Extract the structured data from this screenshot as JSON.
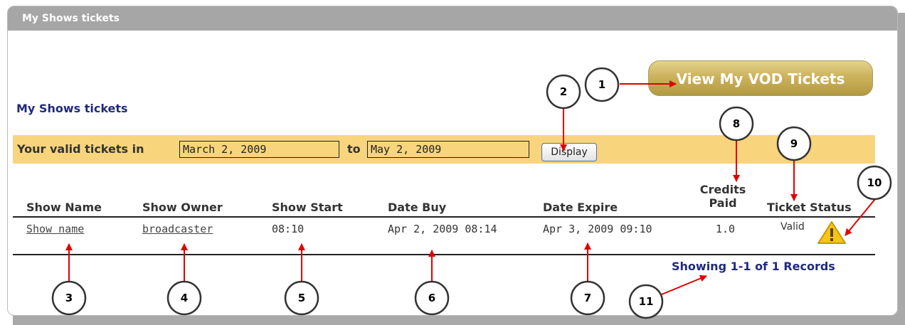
{
  "panel": {
    "header_title": "My Shows tickets"
  },
  "vod_button_label": "View My VOD Tickets",
  "section_title": "My Shows tickets",
  "filter": {
    "prefix_label": "Your valid tickets in",
    "from_value": "March 2, 2009",
    "to_label": "to",
    "to_value": "May 2, 2009",
    "display_label": "Display"
  },
  "table": {
    "headers": {
      "show_name": "Show Name",
      "show_owner": "Show Owner",
      "show_start": "Show Start",
      "date_buy": "Date Buy",
      "date_expire": "Date Expire",
      "credits_paid_line1": "Credits",
      "credits_paid_line2": "Paid",
      "ticket_status": "Ticket Status"
    },
    "rows": [
      {
        "show_name": "Show name",
        "show_owner": "broadcaster",
        "show_start": "08:10",
        "date_buy": "Apr 2, 2009 08:14",
        "date_expire": "Apr 3, 2009 09:10",
        "credits_paid": "1.0",
        "ticket_status": "Valid",
        "status_icon": "warning-icon"
      }
    ],
    "records_summary": "Showing 1-1 of 1 Records"
  },
  "callouts": [
    "1",
    "2",
    "3",
    "4",
    "5",
    "6",
    "7",
    "8",
    "9",
    "10",
    "11"
  ],
  "colors": {
    "header_bg": "#a6a6a6",
    "filter_bar": "#f8d57c",
    "title_navy": "#1f2a7d",
    "vod_gold": "#cdb25c",
    "arrow_red": "#e00000",
    "warning_yellow": "#f5c518"
  }
}
